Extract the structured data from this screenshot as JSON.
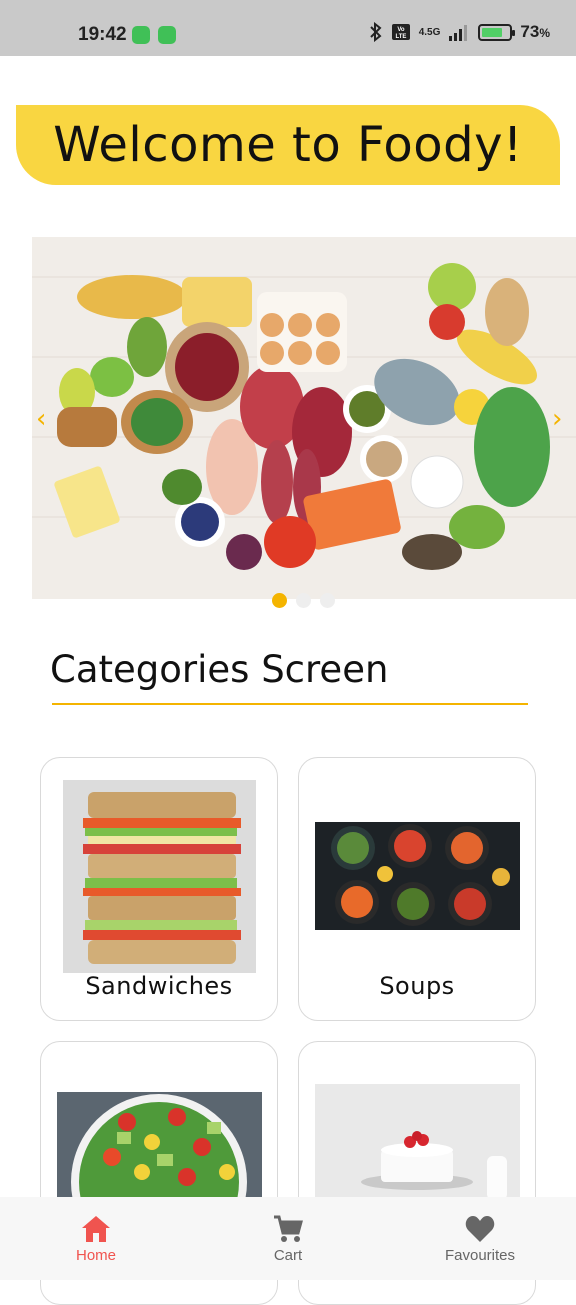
{
  "status_bar": {
    "time": "19:42",
    "battery": "73",
    "battery_unit": "%",
    "network": "4.5G"
  },
  "header": {
    "title": "Welcome to Foody!"
  },
  "carousel": {
    "image_icon": "groceries-photo",
    "active_index": 0,
    "slide_count": 3
  },
  "categories": {
    "title": "Categories Screen",
    "items": [
      {
        "label": "Sandwiches",
        "icon": "sandwich-photo"
      },
      {
        "label": "Soups",
        "icon": "soups-photo"
      },
      {
        "label": "",
        "icon": "salad-photo"
      },
      {
        "label": "",
        "icon": "cake-photo"
      }
    ]
  },
  "bottom_nav": {
    "items": [
      {
        "label": "Home",
        "icon": "home-icon",
        "active": true
      },
      {
        "label": "Cart",
        "icon": "cart-icon",
        "active": false
      },
      {
        "label": "Favourites",
        "icon": "heart-icon",
        "active": false
      }
    ]
  },
  "colors": {
    "accent": "#f4b400",
    "banner": "#f9d641",
    "nav_active": "#f0544f",
    "nav_inactive": "#666666"
  }
}
